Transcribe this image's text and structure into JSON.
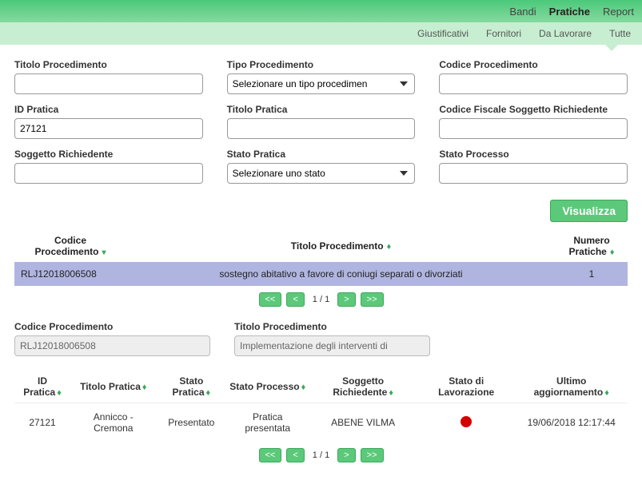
{
  "mainNav": {
    "bandi": "Bandi",
    "pratiche": "Pratiche",
    "report": "Report"
  },
  "subNav": {
    "giustificativi": "Giustificativi",
    "fornitori": "Fornitori",
    "daLavorare": "Da Lavorare",
    "tutte": "Tutte"
  },
  "search": {
    "titoloProcedimento": {
      "label": "Titolo Procedimento",
      "value": ""
    },
    "tipoProcedimento": {
      "label": "Tipo Procedimento",
      "placeholder": "Selezionare un tipo procedimen"
    },
    "codiceProcedimento": {
      "label": "Codice Procedimento",
      "value": ""
    },
    "idPratica": {
      "label": "ID Pratica",
      "value": "27121"
    },
    "titoloPratica": {
      "label": "Titolo Pratica",
      "value": ""
    },
    "codiceFiscale": {
      "label": "Codice Fiscale Soggetto Richiedente",
      "value": ""
    },
    "soggettoRichiedente": {
      "label": "Soggetto Richiedente",
      "value": ""
    },
    "statoPratica": {
      "label": "Stato Pratica",
      "placeholder": "Selezionare uno stato"
    },
    "statoProcesso": {
      "label": "Stato Processo",
      "value": ""
    }
  },
  "actions": {
    "visualizza": "Visualizza"
  },
  "table1": {
    "headers": {
      "codice": "Codice Procedimento",
      "titolo": "Titolo Procedimento",
      "numero": "Numero Pratiche"
    },
    "rows": [
      {
        "codice": "RLJ12018006508",
        "titolo": "sostegno abitativo a favore di coniugi separati o divorziati",
        "numero": "1"
      }
    ]
  },
  "pager1": {
    "first": "<<",
    "prev": "<",
    "info": "1 / 1",
    "next": ">",
    "last": ">>"
  },
  "detail": {
    "codiceProcedimento": {
      "label": "Codice Procedimento",
      "value": "RLJ12018006508"
    },
    "titoloProcedimento": {
      "label": "Titolo Procedimento",
      "value": "Implementazione degli interventi di"
    }
  },
  "table2": {
    "headers": {
      "idPratica": "ID Pratica",
      "titoloPratica": "Titolo Pratica",
      "statoPratica": "Stato Pratica",
      "statoProcesso": "Stato Processo",
      "soggetto": "Soggetto Richiedente",
      "statoLavorazione": "Stato di Lavorazione",
      "ultimo": "Ultimo aggiornamento"
    },
    "rows": [
      {
        "idPratica": "27121",
        "titoloPratica": "Annicco - Cremona",
        "statoPratica": "Presentato",
        "statoProcesso": "Pratica presentata",
        "soggetto": "ABENE VILMA",
        "statoLavorazioneColor": "#d40000",
        "ultimo": "19/06/2018 12:17:44"
      }
    ]
  },
  "pager2": {
    "first": "<<",
    "prev": "<",
    "info": "1 / 1",
    "next": ">",
    "last": ">>"
  }
}
